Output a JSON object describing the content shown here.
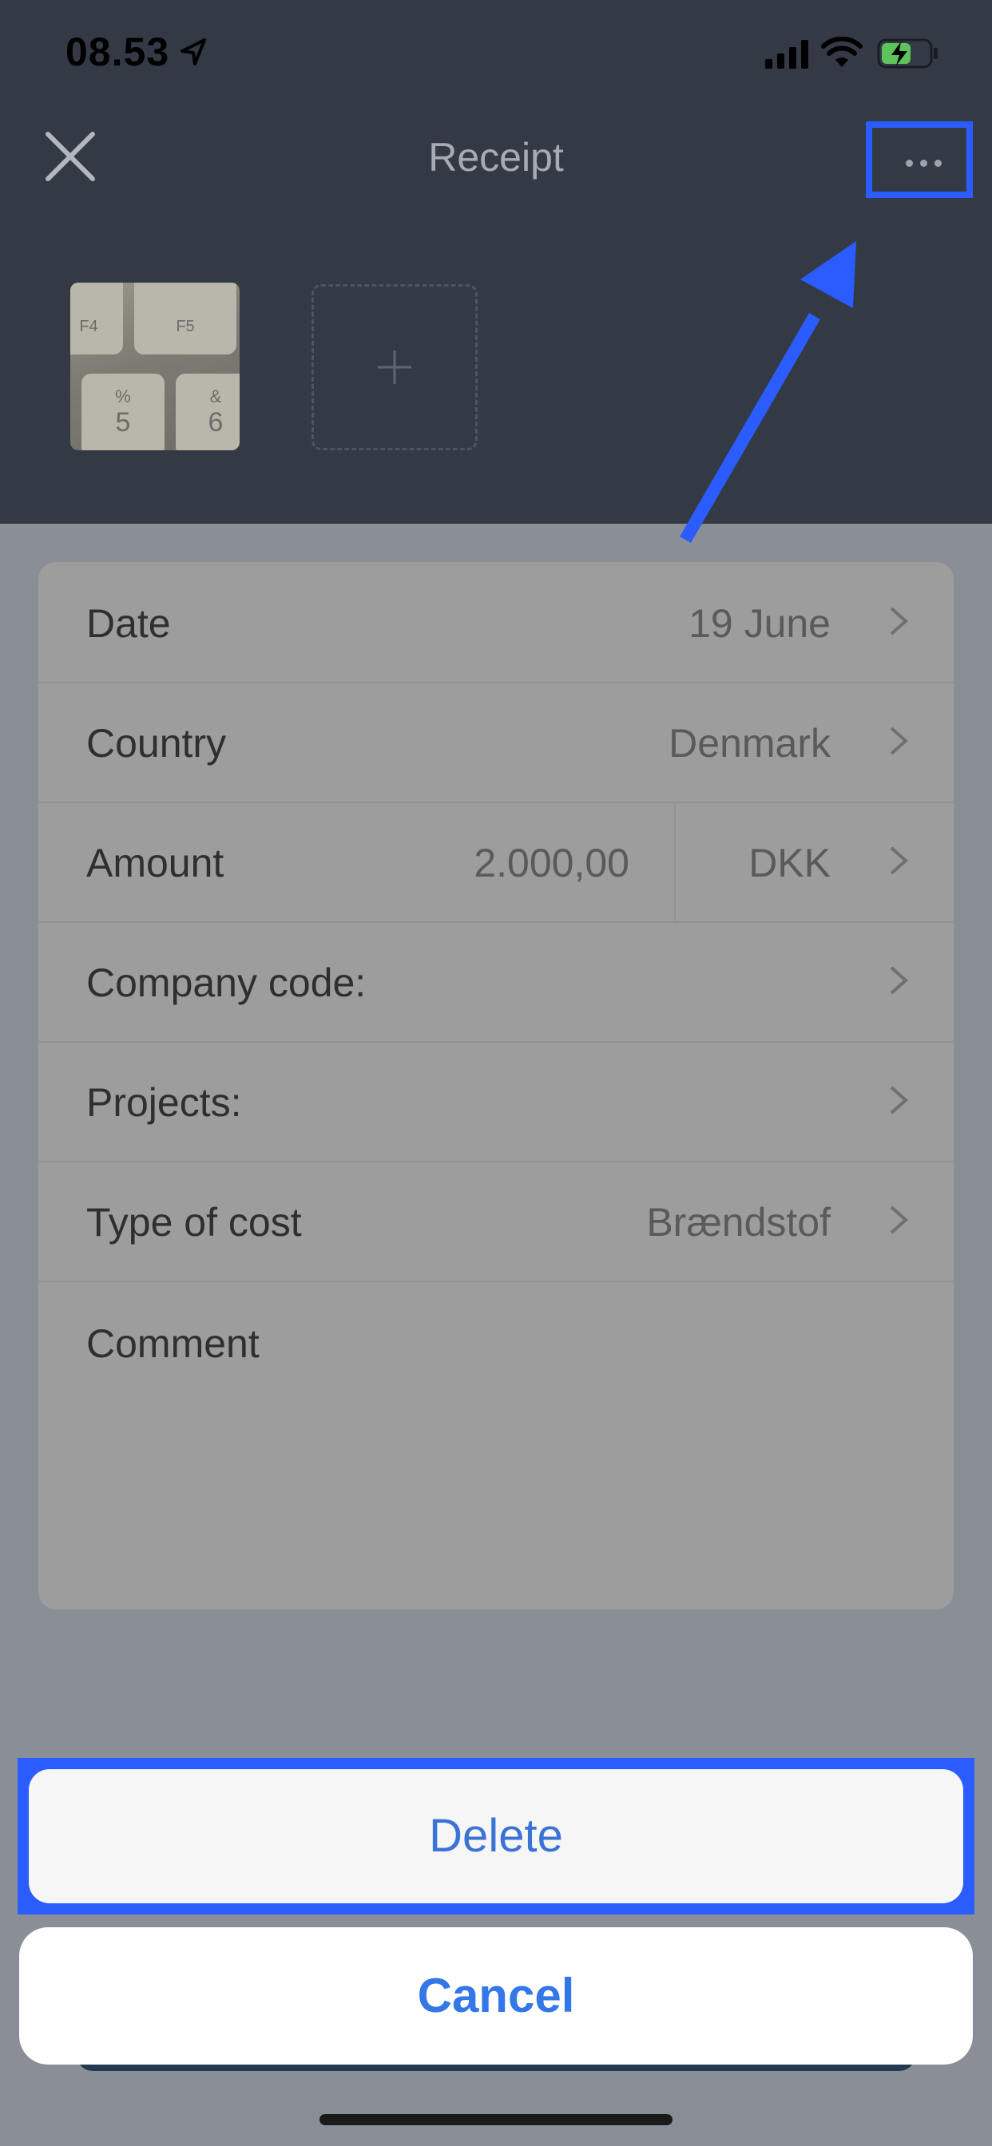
{
  "status_bar": {
    "time": "08.53"
  },
  "header": {
    "title": "Receipt"
  },
  "thumbnail": {
    "keys": [
      "F4",
      "F5",
      "%",
      "5",
      "&",
      "6"
    ]
  },
  "form": {
    "rows": [
      {
        "label": "Date",
        "value": "19 June"
      },
      {
        "label": "Country",
        "value": "Denmark"
      },
      {
        "label": "Amount",
        "value": "2.000,00",
        "currency": "DKK"
      },
      {
        "label": "Company code:",
        "value": ""
      },
      {
        "label": "Projects:",
        "value": ""
      },
      {
        "label": "Type of cost",
        "value": "Brændstof"
      }
    ],
    "comment_label": "Comment"
  },
  "action_sheet": {
    "delete_label": "Delete",
    "cancel_label": "Cancel"
  },
  "colors": {
    "highlight": "#2b5cff",
    "header_bg": "#333a46",
    "action_text": "#3a73d6"
  },
  "icons": [
    "location-arrow-icon",
    "signal-icon",
    "wifi-icon",
    "battery-icon",
    "close-icon",
    "more-icon",
    "plus-icon",
    "chevron-right-icon"
  ]
}
